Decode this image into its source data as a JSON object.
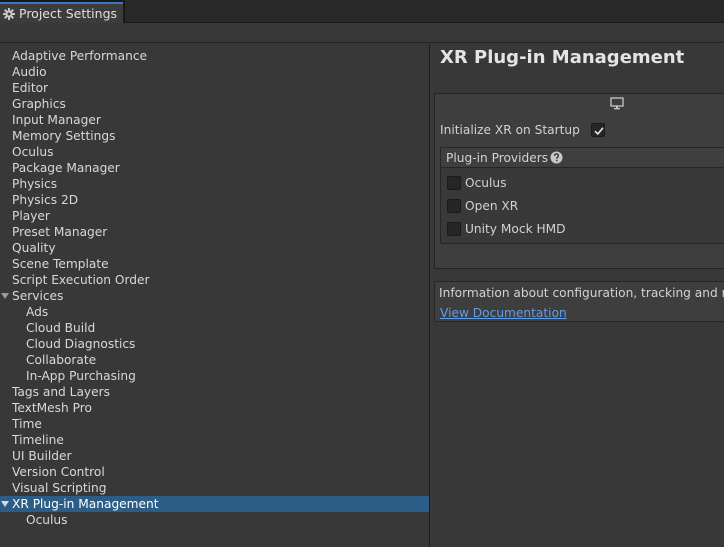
{
  "window": {
    "tab_title": "Project Settings"
  },
  "sidebar": {
    "items": [
      {
        "label": "Adaptive Performance",
        "indent": 0
      },
      {
        "label": "Audio",
        "indent": 0
      },
      {
        "label": "Editor",
        "indent": 0
      },
      {
        "label": "Graphics",
        "indent": 0
      },
      {
        "label": "Input Manager",
        "indent": 0
      },
      {
        "label": "Memory Settings",
        "indent": 0
      },
      {
        "label": "Oculus",
        "indent": 0
      },
      {
        "label": "Package Manager",
        "indent": 0
      },
      {
        "label": "Physics",
        "indent": 0
      },
      {
        "label": "Physics 2D",
        "indent": 0
      },
      {
        "label": "Player",
        "indent": 0
      },
      {
        "label": "Preset Manager",
        "indent": 0
      },
      {
        "label": "Quality",
        "indent": 0
      },
      {
        "label": "Scene Template",
        "indent": 0
      },
      {
        "label": "Script Execution Order",
        "indent": 0
      },
      {
        "label": "Services",
        "indent": 0,
        "expanded": true
      },
      {
        "label": "Ads",
        "indent": 1
      },
      {
        "label": "Cloud Build",
        "indent": 1
      },
      {
        "label": "Cloud Diagnostics",
        "indent": 1
      },
      {
        "label": "Collaborate",
        "indent": 1
      },
      {
        "label": "In-App Purchasing",
        "indent": 1
      },
      {
        "label": "Tags and Layers",
        "indent": 0
      },
      {
        "label": "TextMesh Pro",
        "indent": 0
      },
      {
        "label": "Time",
        "indent": 0
      },
      {
        "label": "Timeline",
        "indent": 0
      },
      {
        "label": "UI Builder",
        "indent": 0
      },
      {
        "label": "Version Control",
        "indent": 0
      },
      {
        "label": "Visual Scripting",
        "indent": 0
      },
      {
        "label": "XR Plug-in Management",
        "indent": 0,
        "expanded": true,
        "selected": true
      },
      {
        "label": "Oculus",
        "indent": 1
      }
    ]
  },
  "main": {
    "title": "XR Plug-in Management",
    "platform_icon": "monitor-icon",
    "initialize_label": "Initialize XR on Startup",
    "initialize_checked": true,
    "providers": {
      "header": "Plug-in Providers",
      "help_icon": "help-icon",
      "items": [
        {
          "label": "Oculus",
          "checked": false
        },
        {
          "label": "Open XR",
          "checked": false
        },
        {
          "label": "Unity Mock HMD",
          "checked": false
        }
      ]
    },
    "info": {
      "text": "Information about configuration, tracking and migra",
      "link": "View Documentation"
    }
  },
  "colors": {
    "selection": "#2c5d87",
    "link": "#5e9eea",
    "tab_accent": "#3a78c4"
  }
}
